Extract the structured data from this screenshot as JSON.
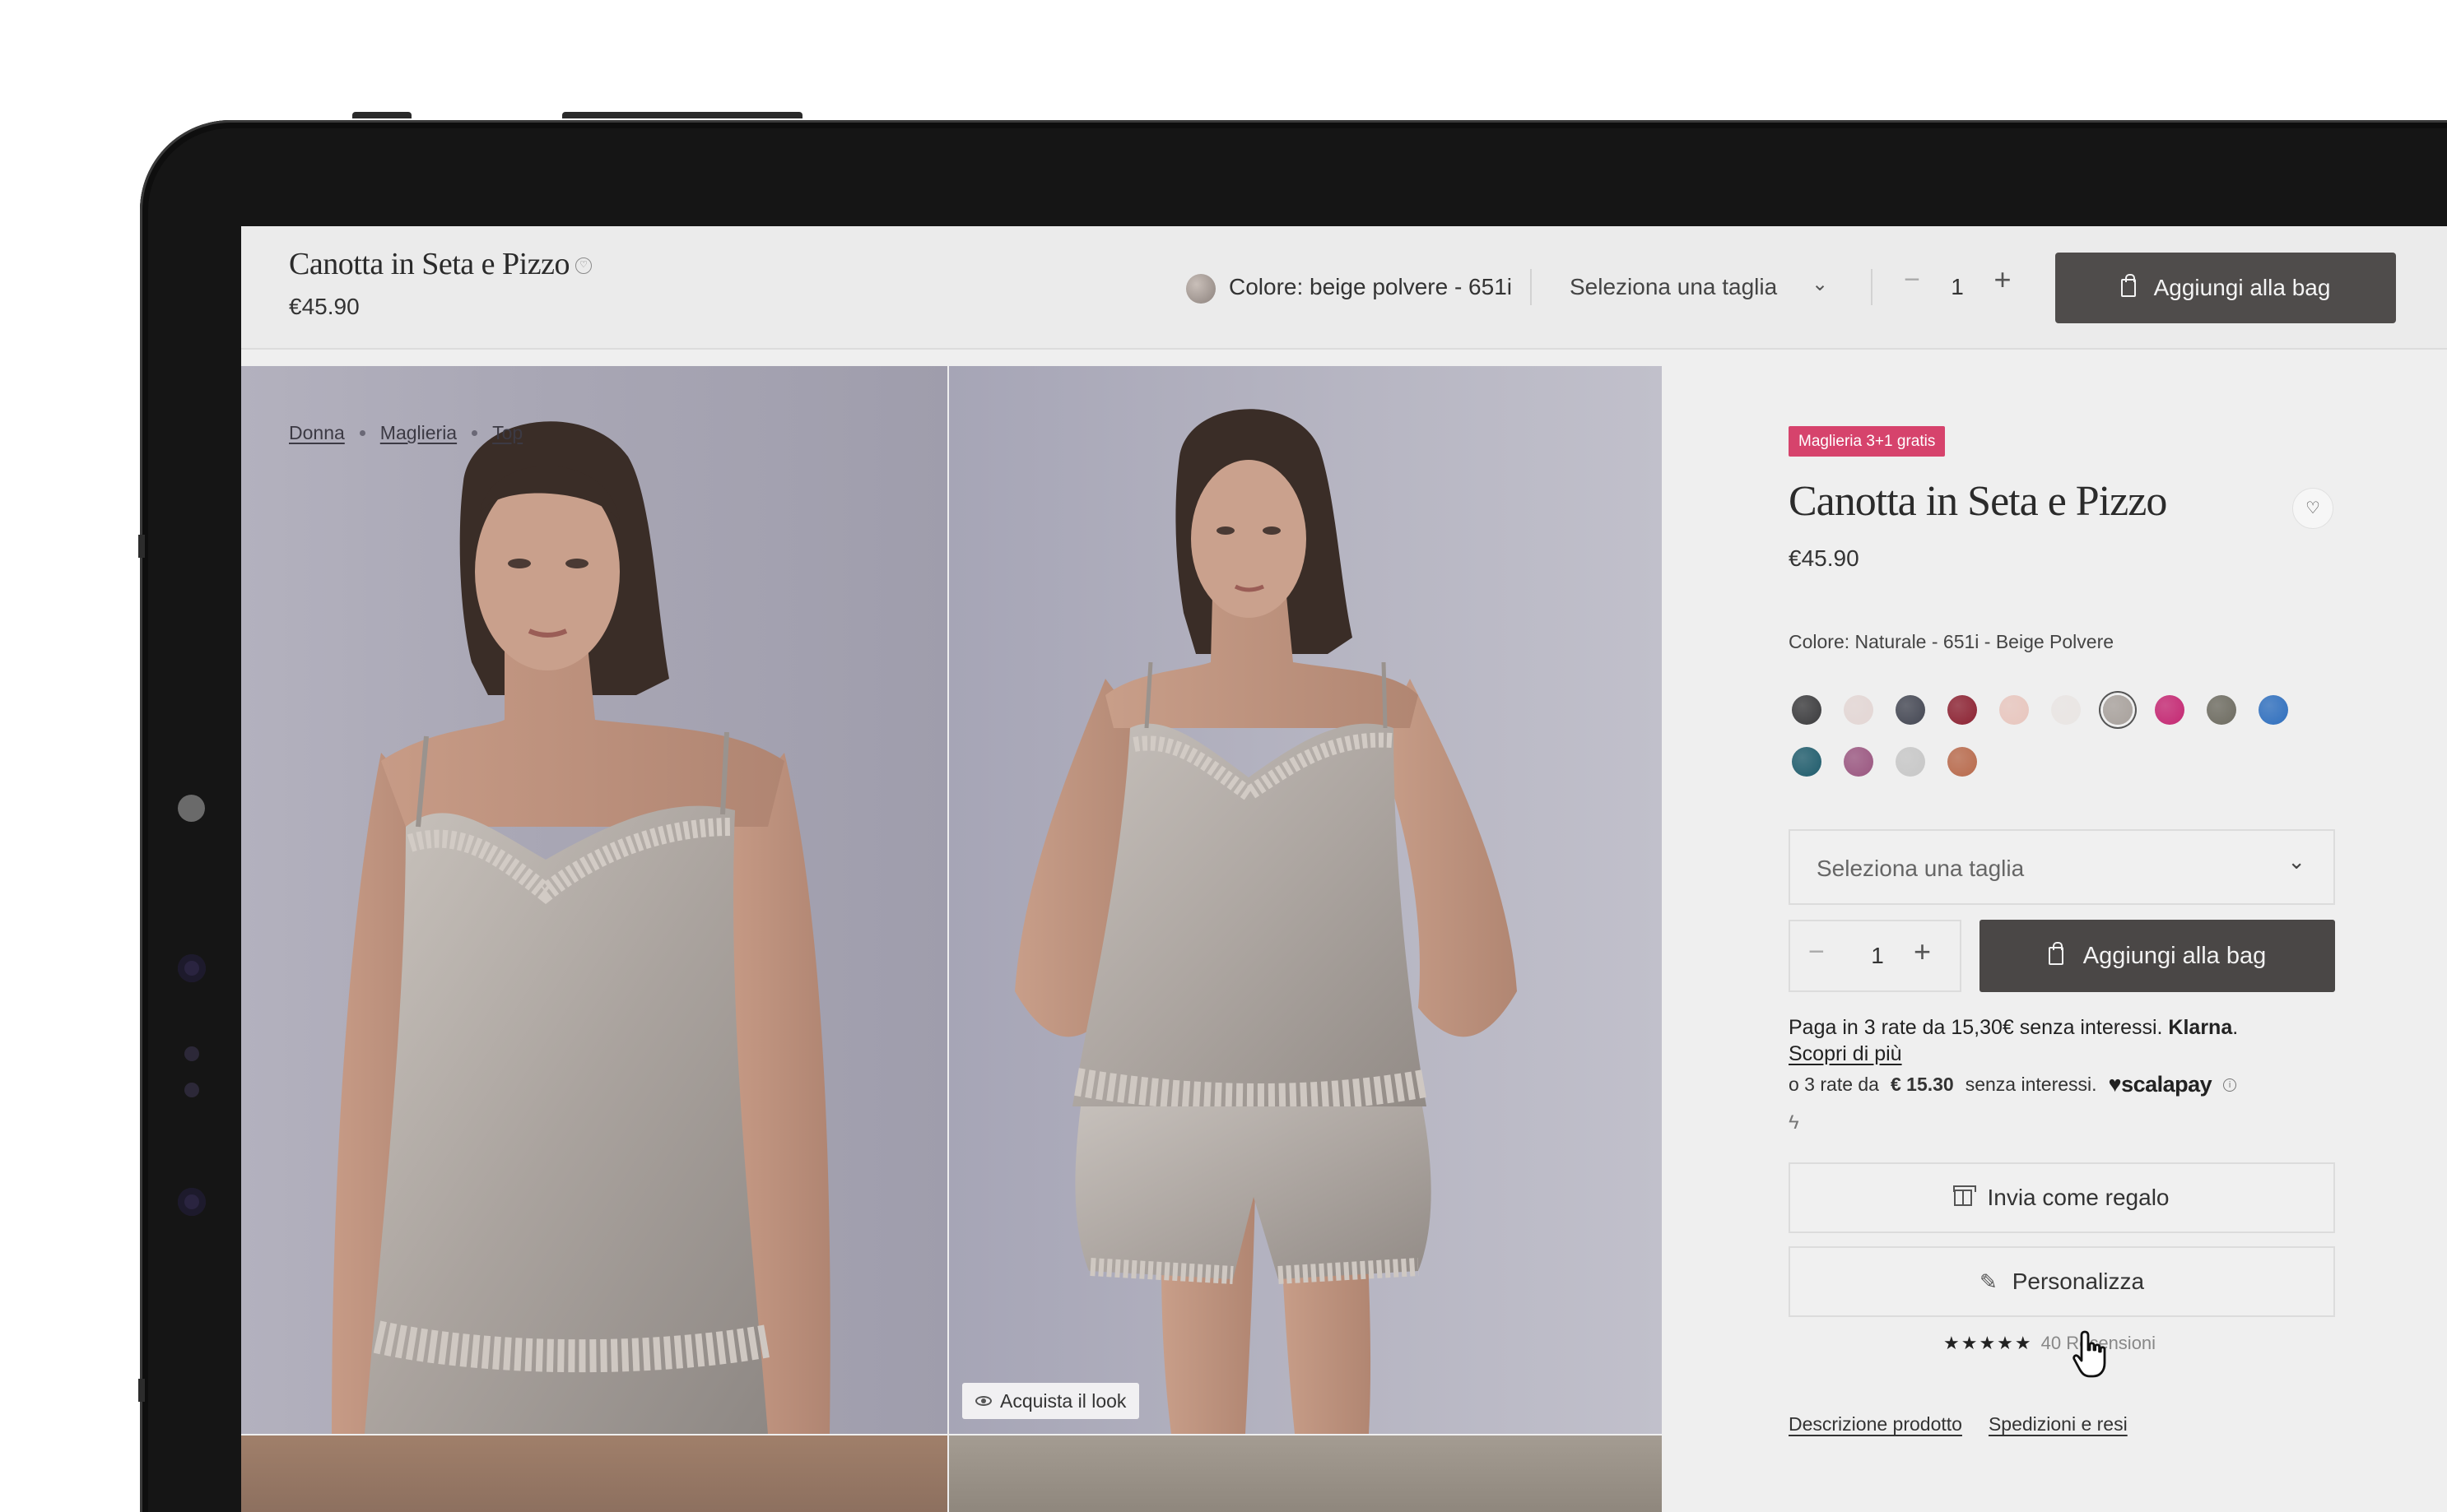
{
  "sticky_bar": {
    "title": "Canotta in Seta e Pizzo",
    "price": "€45.90",
    "color_label": "Colore: beige polvere - 651i",
    "size_placeholder": "Seleziona una taglia",
    "quantity": "1",
    "add_to_bag": "Aggiungi alla bag"
  },
  "breadcrumb": [
    "Donna",
    "Maglieria",
    "Top"
  ],
  "gallery": {
    "shop_look": "Acquista il look"
  },
  "product": {
    "promo_badge": "Maglieria 3+1 gratis",
    "title": "Canotta in Seta e Pizzo",
    "price": "€45.90",
    "color_label": "Colore: Naturale - 651i - Beige Polvere",
    "swatches": [
      "#3b3b3d",
      "#e3d6d4",
      "#444753",
      "#8c2232",
      "#e8c6be",
      "#e9e5e3",
      "#a8a19c",
      "#c42772",
      "#6d6b60",
      "#2f6fbe",
      "#1f5c6c",
      "#9a5680",
      "#c7c7c7",
      "#b86a4c"
    ],
    "selected_swatch_index": 6,
    "size_placeholder": "Seleziona una taglia",
    "quantity": "1",
    "add_to_bag": "Aggiungi alla bag",
    "klarna_text": "Paga in 3 rate da 15,30€ senza interessi.",
    "klarna_brand": "Klarna",
    "klarna_link": "Scopri di più",
    "scalapay_prefix": "o 3 rate da",
    "scalapay_amount": "€ 15.30",
    "scalapay_suffix": "senza interessi.",
    "scalapay_brand": "scalapay",
    "gift_button": "Invia come regalo",
    "personalize_button": "Personalizza",
    "rating_stars": 5,
    "reviews_label": "40 Recensioni",
    "tab_description": "Descrizione prodotto",
    "tab_shipping": "Spedizioni e resi"
  }
}
